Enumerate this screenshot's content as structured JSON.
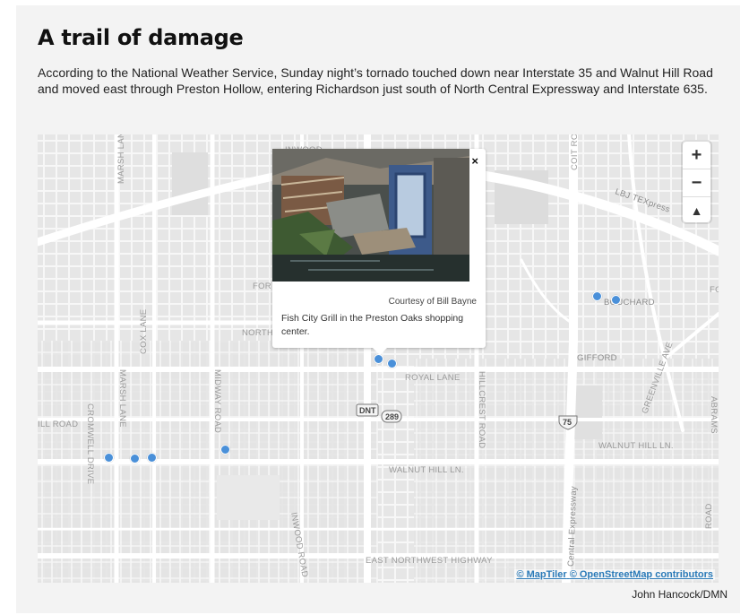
{
  "header": {
    "title": "A trail of damage",
    "intro": "According to the National Weather Service, Sunday night’s tornado touched down near Interstate 35 and Walnut Hill Road and moved east through Preston Hollow, entering Richardson just south of North Central Expressway and Interstate 635."
  },
  "map": {
    "zoom_in": "+",
    "zoom_out": "−",
    "compass": "▲",
    "labels": {
      "inwood": "INWOOD",
      "marsh_lane_n": "MARSH LANE",
      "coit_road": "COIT ROAD",
      "lbj_texpress": "LBJ TEXpress",
      "forest": "FOR",
      "forest_e": "FO",
      "northaven": "NORTHA",
      "bouchard": "BOUCHARD",
      "cox_lane": "COX LANE",
      "crowwell": "CROMWELL DRIVE",
      "marsh_lane_s": "MARSH LANE",
      "midway": "MIDWAY ROAD",
      "royal_lane": "ROYAL LANE",
      "hillcrest": "HILLCREST ROAD",
      "gifford": "GIFFORD",
      "greenville": "GREENVILLE AVE",
      "abrams": "ABRAMS",
      "ill_road": "ILL ROAD",
      "walnut_hill": "WALNUT HILL LN.",
      "walnut_hill_e": "WALNUT HILL LN.",
      "inwood_road": "INWOOD ROAD",
      "central_expy": "Central Expressway",
      "northwest_hwy": "EAST NORTHWEST HIGHWAY",
      "skillman": "ROAD"
    },
    "shields": {
      "dnt": "DNT",
      "sh289": "289",
      "us75": "75"
    },
    "markers_count_note": "",
    "attribution": {
      "maptiler": "© MapTiler",
      "osm": "© OpenStreetMap contributors"
    }
  },
  "popup": {
    "close": "×",
    "credit": "Courtesy of Bill Bayne",
    "caption": "Fish City Grill in the Preston Oaks shopping center."
  },
  "byline": "John Hancock/DMN",
  "colors": {
    "marker": "#4a90d9",
    "map_bg": "#ececec",
    "road": "#ffffff",
    "link": "#2a7ab8"
  }
}
